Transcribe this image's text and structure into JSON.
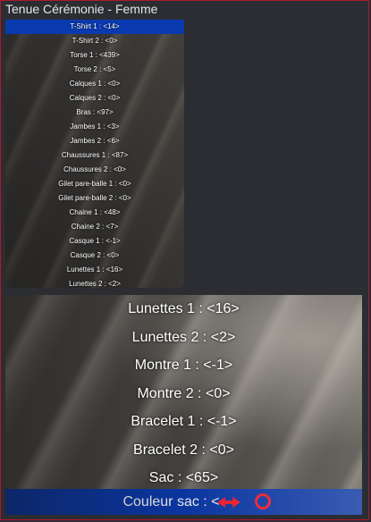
{
  "window": {
    "title": "Tenue Cérémonie - Femme"
  },
  "top_menu": {
    "items": [
      "T-Shirt 1 : <14>",
      "T-Shirt 2 : <0>",
      "Torse 1 : <439>",
      "Torse 2 : <5>",
      "Calques 1 : <0>",
      "Calques 2 : <0>",
      "Bras : <97>",
      "Jambes 1 : <3>",
      "Jambes 2 : <6>",
      "Chaussures 1 : <87>",
      "Chaussures 2 : <0>",
      "Gilet pare-balle 1 : <0>",
      "Gilet pare-balle 2 : <0>",
      "Chaine 1 : <48>",
      "Chaine 2 : <7>",
      "Casque 1 : <-1>",
      "Casque 2 : <0>",
      "Lunettes 1 : <16>",
      "Lunettes 2 : <2>"
    ],
    "selected_index": 0
  },
  "bottom_menu": {
    "items": [
      "Lunettes 1 : <16>",
      "Lunettes 2 : <2>",
      "Montre 1 : <-1>",
      "Montre 2 : <0>",
      "Bracelet 1 : <-1>",
      "Bracelet 2 : <0>",
      "Sac : <65>"
    ],
    "selected_label": "Couleur sac : <",
    "selected_icons": [
      "red-arrow-icon",
      "red-ring-icon"
    ]
  },
  "colors": {
    "selection": "#0a3ab0",
    "border": "#b0182a",
    "marker": "#ff1b2d"
  }
}
